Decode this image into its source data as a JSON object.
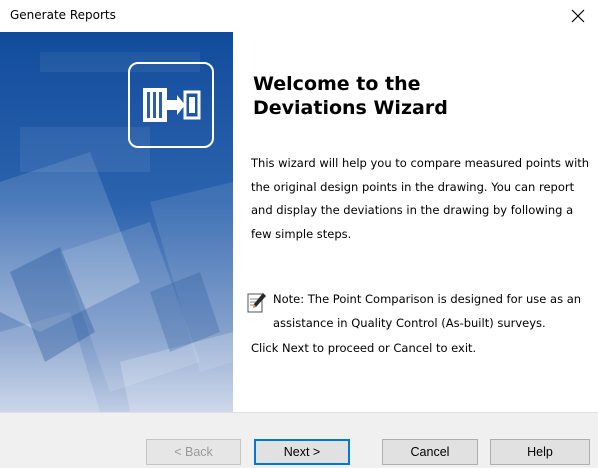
{
  "window": {
    "title": "Generate Reports",
    "close_icon": "close-icon"
  },
  "banner": {
    "icon": "deviations-wizard-icon",
    "colors": {
      "top": "#114c9c",
      "bottom": "#c0cde4"
    }
  },
  "content": {
    "heading_line1": "Welcome to the",
    "heading_line2": "Deviations Wizard",
    "intro": "This wizard will help you to compare measured points with the original design points in the drawing. You can report and display the deviations in the drawing by following a few simple steps.",
    "note_icon": "note-pencil-icon",
    "note": "Note: The Point Comparison is designed for use as an assistance in Quality Control (As-built) surveys.",
    "proceed": "Click Next to proceed or Cancel to exit."
  },
  "buttons": {
    "back": "< Back",
    "next": "Next >",
    "cancel": "Cancel",
    "help": "Help"
  },
  "colors": {
    "accent": "#0078d7",
    "footer_bg": "#f0f0f0",
    "disabled_text": "#9a9a9a"
  }
}
